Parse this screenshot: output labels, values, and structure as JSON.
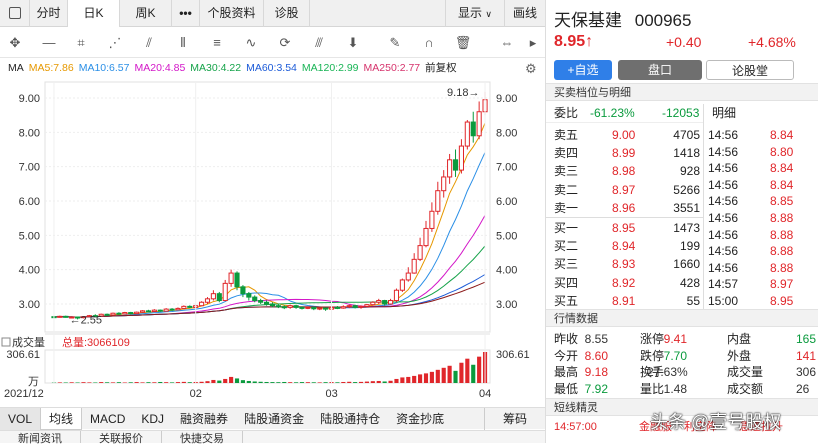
{
  "top_tabs": [
    "分时",
    "日K",
    "周K",
    "•••",
    "个股资料",
    "诊股"
  ],
  "top_right": {
    "display": "显示",
    "draw": "画线"
  },
  "ma": [
    {
      "label": "MA",
      "color": "#222"
    },
    {
      "label": "MA5:7.86",
      "color": "#e69800"
    },
    {
      "label": "MA10:6.57",
      "color": "#2b8fe6"
    },
    {
      "label": "MA20:4.85",
      "color": "#d317c8"
    },
    {
      "label": "MA30:4.22",
      "color": "#16a34a"
    },
    {
      "label": "MA60:3.54",
      "color": "#1c5bd8"
    },
    {
      "label": "MA120:2.99",
      "color": "#18b455"
    },
    {
      "label": "MA250:2.77",
      "color": "#d6336c"
    },
    {
      "label": "前复权",
      "color": "#222"
    }
  ],
  "annotations": {
    "high": "9.18→",
    "low": "←2.55"
  },
  "chart_data": {
    "type": "candlestick",
    "y_ticks": [
      "9.00",
      "8.00",
      "7.00",
      "6.00",
      "5.00",
      "4.00",
      "3.00"
    ],
    "x_ticks": [
      "2021/12",
      "02",
      "03",
      "04"
    ],
    "volume_label": "成交量",
    "volume_total": "总量:3066109",
    "volume_ticks": [
      "306.61",
      "万"
    ],
    "high": 9.18,
    "low": 2.55,
    "candles": [
      [
        2.63,
        2.62,
        2.66,
        2.58
      ],
      [
        2.62,
        2.64,
        2.66,
        2.6
      ],
      [
        2.64,
        2.61,
        2.66,
        2.6
      ],
      [
        2.61,
        2.62,
        2.64,
        2.58
      ],
      [
        2.62,
        2.6,
        2.63,
        2.55
      ],
      [
        2.6,
        2.63,
        2.65,
        2.58
      ],
      [
        2.63,
        2.66,
        2.68,
        2.62
      ],
      [
        2.66,
        2.65,
        2.7,
        2.63
      ],
      [
        2.65,
        2.7,
        2.72,
        2.64
      ],
      [
        2.7,
        2.68,
        2.72,
        2.66
      ],
      [
        2.68,
        2.73,
        2.75,
        2.67
      ],
      [
        2.73,
        2.71,
        2.76,
        2.69
      ],
      [
        2.71,
        2.75,
        2.77,
        2.7
      ],
      [
        2.75,
        2.72,
        2.77,
        2.7
      ],
      [
        2.72,
        2.76,
        2.78,
        2.71
      ],
      [
        2.76,
        2.8,
        2.82,
        2.74
      ],
      [
        2.8,
        2.78,
        2.83,
        2.76
      ],
      [
        2.78,
        2.82,
        2.85,
        2.77
      ],
      [
        2.82,
        2.79,
        2.84,
        2.77
      ],
      [
        2.79,
        2.85,
        2.88,
        2.78
      ],
      [
        2.85,
        2.83,
        2.88,
        2.8
      ],
      [
        2.83,
        2.87,
        2.9,
        2.82
      ],
      [
        2.87,
        2.93,
        2.96,
        2.86
      ],
      [
        2.93,
        2.9,
        2.96,
        2.88
      ],
      [
        2.9,
        2.95,
        2.98,
        2.89
      ],
      [
        2.95,
        3.05,
        3.08,
        2.94
      ],
      [
        3.05,
        3.15,
        3.2,
        3.0
      ],
      [
        3.15,
        3.3,
        3.4,
        3.1
      ],
      [
        3.3,
        3.1,
        3.35,
        3.05
      ],
      [
        3.1,
        3.6,
        3.7,
        3.08
      ],
      [
        3.6,
        3.9,
        4.0,
        3.5
      ],
      [
        3.9,
        3.5,
        3.95,
        3.4
      ],
      [
        3.5,
        3.3,
        3.55,
        3.2
      ],
      [
        3.3,
        3.2,
        3.35,
        3.1
      ],
      [
        3.2,
        3.1,
        3.25,
        3.05
      ],
      [
        3.1,
        3.05,
        3.15,
        3.0
      ],
      [
        3.05,
        3.0,
        3.1,
        2.95
      ],
      [
        3.0,
        2.95,
        3.05,
        2.9
      ],
      [
        2.95,
        2.92,
        3.0,
        2.88
      ],
      [
        2.92,
        2.9,
        2.96,
        2.85
      ],
      [
        2.9,
        2.95,
        2.98,
        2.86
      ],
      [
        2.95,
        2.9,
        2.98,
        2.86
      ],
      [
        2.9,
        2.88,
        2.93,
        2.84
      ],
      [
        2.88,
        2.9,
        2.93,
        2.85
      ],
      [
        2.9,
        2.86,
        2.92,
        2.82
      ],
      [
        2.86,
        2.88,
        2.9,
        2.82
      ],
      [
        2.88,
        2.85,
        2.9,
        2.8
      ],
      [
        2.85,
        2.9,
        2.92,
        2.82
      ],
      [
        2.9,
        2.88,
        2.94,
        2.85
      ],
      [
        2.88,
        2.92,
        2.96,
        2.86
      ],
      [
        2.92,
        2.95,
        2.98,
        2.88
      ],
      [
        2.95,
        2.9,
        2.98,
        2.87
      ],
      [
        2.9,
        2.93,
        2.96,
        2.86
      ],
      [
        2.93,
        2.98,
        3.0,
        2.9
      ],
      [
        2.98,
        3.05,
        3.08,
        2.95
      ],
      [
        3.05,
        3.1,
        3.15,
        3.0
      ],
      [
        3.1,
        3.0,
        3.12,
        2.95
      ],
      [
        3.0,
        3.1,
        3.15,
        2.98
      ],
      [
        3.1,
        3.4,
        3.45,
        3.05
      ],
      [
        3.4,
        3.7,
        3.74,
        3.35
      ],
      [
        3.7,
        3.9,
        4.07,
        3.65
      ],
      [
        3.9,
        4.3,
        4.48,
        3.88
      ],
      [
        4.3,
        4.7,
        4.93,
        4.25
      ],
      [
        4.7,
        5.2,
        5.42,
        4.65
      ],
      [
        5.2,
        5.7,
        5.96,
        5.1
      ],
      [
        5.7,
        6.3,
        6.56,
        5.6
      ],
      [
        6.3,
        6.7,
        6.9,
        6.1
      ],
      [
        6.7,
        7.2,
        7.37,
        6.5
      ],
      [
        7.2,
        6.9,
        7.5,
        6.7
      ],
      [
        6.9,
        7.6,
        7.8,
        6.8
      ],
      [
        7.6,
        8.3,
        8.36,
        7.5
      ],
      [
        8.3,
        7.9,
        8.6,
        7.7
      ],
      [
        7.9,
        8.6,
        8.9,
        7.8
      ],
      [
        8.6,
        8.95,
        9.18,
        8.5
      ]
    ],
    "volumes": [
      4,
      6,
      5,
      7,
      5,
      8,
      6,
      5,
      9,
      7,
      6,
      8,
      5,
      7,
      9,
      6,
      8,
      7,
      10,
      8,
      6,
      9,
      11,
      8,
      10,
      12,
      18,
      30,
      24,
      40,
      60,
      45,
      28,
      20,
      15,
      12,
      10,
      9,
      8,
      10,
      8,
      7,
      9,
      8,
      7,
      6,
      8,
      9,
      7,
      10,
      12,
      9,
      11,
      14,
      18,
      20,
      15,
      22,
      40,
      55,
      60,
      70,
      85,
      95,
      110,
      130,
      150,
      170,
      120,
      200,
      240,
      180,
      260,
      306
    ],
    "ma_series": [
      {
        "name": "MA5",
        "color": "#e69800"
      },
      {
        "name": "MA10",
        "color": "#2b8fe6"
      },
      {
        "name": "MA20",
        "color": "#d317c8"
      },
      {
        "name": "MA30",
        "color": "#16a34a"
      },
      {
        "name": "MA60",
        "color": "#1c5bd8"
      },
      {
        "name": "MA250",
        "color": "#8b1a1a"
      }
    ]
  },
  "bottom_tabs": [
    "VOL",
    "均线",
    "MACD",
    "KDJ",
    "融资融券",
    "陆股通资金",
    "陆股通持仓",
    "资金抄底",
    "筹码"
  ],
  "bottom_tabs2": [
    "新闻资讯",
    "关联报价",
    "快捷交易"
  ],
  "stock": {
    "name": "天保基建",
    "code": "000965",
    "price": "8.95",
    "arrow": "↑",
    "change": "+0.40",
    "pct": "+4.68%"
  },
  "buttons": {
    "add": "+自选",
    "pankou": "盘口",
    "forum": "论股堂"
  },
  "order_section": "买卖档位与明细",
  "ratio": {
    "label": "委比",
    "pct": "-61.23%",
    "val": "-12053",
    "detail": "明细"
  },
  "asks": [
    {
      "label": "卖五",
      "price": "9.00",
      "vol": "4705"
    },
    {
      "label": "卖四",
      "price": "8.99",
      "vol": "1418"
    },
    {
      "label": "卖三",
      "price": "8.98",
      "vol": "928"
    },
    {
      "label": "卖二",
      "price": "8.97",
      "vol": "5266"
    },
    {
      "label": "卖一",
      "price": "8.96",
      "vol": "3551"
    }
  ],
  "bids": [
    {
      "label": "买一",
      "price": "8.95",
      "vol": "1473"
    },
    {
      "label": "买二",
      "price": "8.94",
      "vol": "199"
    },
    {
      "label": "买三",
      "price": "8.93",
      "vol": "1660"
    },
    {
      "label": "买四",
      "price": "8.92",
      "vol": "428"
    },
    {
      "label": "买五",
      "price": "8.91",
      "vol": "55"
    }
  ],
  "ticks": [
    {
      "time": "14:56",
      "price": "8.84",
      "color": "red"
    },
    {
      "time": "14:56",
      "price": "8.80",
      "color": "red"
    },
    {
      "time": "14:56",
      "price": "8.84",
      "color": "red"
    },
    {
      "time": "14:56",
      "price": "8.84",
      "color": "red"
    },
    {
      "time": "14:56",
      "price": "8.85",
      "color": "red"
    },
    {
      "time": "14:56",
      "price": "8.88",
      "color": "red"
    },
    {
      "time": "14:56",
      "price": "8.88",
      "color": "red"
    },
    {
      "time": "14:56",
      "price": "8.88",
      "color": "red"
    },
    {
      "time": "14:56",
      "price": "8.88",
      "color": "red"
    },
    {
      "time": "14:57",
      "price": "8.97",
      "color": "red"
    },
    {
      "time": "15:00",
      "price": "8.95",
      "color": "red"
    }
  ],
  "quote_section": "行情数据",
  "quotes": [
    [
      {
        "k": "昨收",
        "v": "8.55",
        "c": "gray"
      },
      {
        "k": "涨停",
        "v": "9.41",
        "c": "red"
      },
      {
        "k": "内盘",
        "v": "165",
        "c": "green"
      }
    ],
    [
      {
        "k": "今开",
        "v": "8.60",
        "c": "red"
      },
      {
        "k": "跌停",
        "v": "7.70",
        "c": "green"
      },
      {
        "k": "外盘",
        "v": "141",
        "c": "red"
      }
    ],
    [
      {
        "k": "最高",
        "v": "9.18",
        "c": "red"
      },
      {
        "k": "换手",
        "v": "27.63%",
        "c": "gray"
      },
      {
        "k": "成交量",
        "v": "306",
        "c": "gray"
      }
    ],
    [
      {
        "k": "最低",
        "v": "7.92",
        "c": "green"
      },
      {
        "k": "量比",
        "v": "1.48",
        "c": "gray"
      },
      {
        "k": "成交额",
        "v": "26",
        "c": "gray"
      }
    ]
  ],
  "brief_section": "短线精灵",
  "brief_last": {
    "time": "14:57:00",
    "a": "金融服",
    "b": "利空降",
    "c": "急速拉升"
  },
  "watermark": "头条 @壹号股权"
}
